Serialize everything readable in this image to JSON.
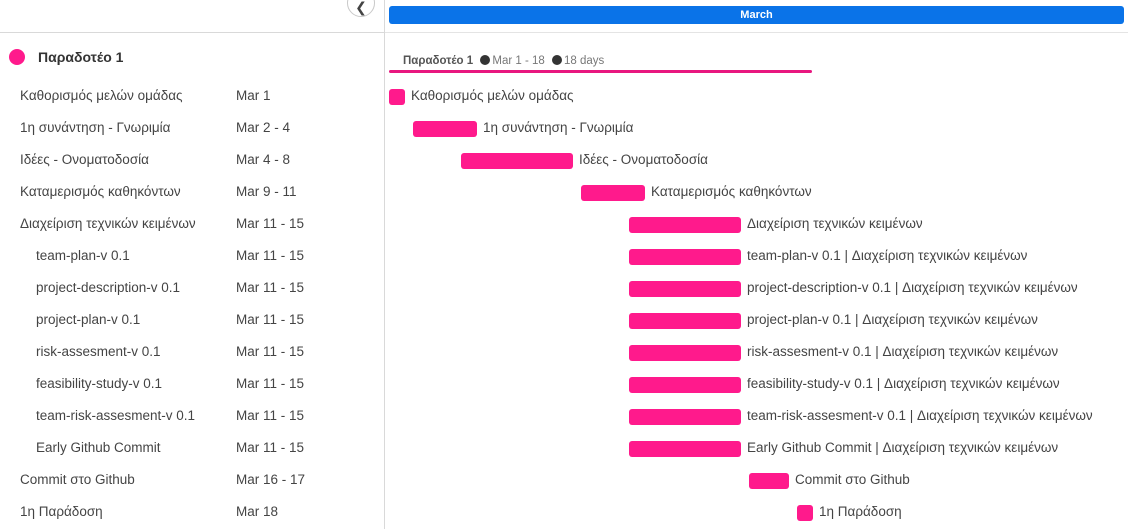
{
  "timeline": {
    "month": "March",
    "summary": {
      "title": "Παραδοτέο 1",
      "range": "Mar 1 - 18",
      "duration": "18 days"
    }
  },
  "group": {
    "title": "Παραδοτέο 1",
    "color": "#ff1a8c"
  },
  "collapse_icon": "chevron-left-icon",
  "tasks": [
    {
      "name": "Καθορισμός μελών ομάδας",
      "dates": "Mar 1",
      "start": 1,
      "end": 1,
      "bar_label": "Καθορισμός μελών ομάδας",
      "indent": false
    },
    {
      "name": "1η συνάντηση - Γνωριμία",
      "dates": "Mar 2 - 4",
      "start": 2,
      "end": 4,
      "bar_label": "1η συνάντηση - Γνωριμία",
      "indent": false
    },
    {
      "name": "Ιδέες - Ονοματοδοσία",
      "dates": "Mar 4 - 8",
      "start": 4,
      "end": 8,
      "bar_label": "Ιδέες - Ονοματοδοσία",
      "indent": false
    },
    {
      "name": "Καταμερισμός καθηκόντων",
      "dates": "Mar 9 - 11",
      "start": 9,
      "end": 11,
      "bar_label": "Καταμερισμός καθηκόντων",
      "indent": false
    },
    {
      "name": "Διαχείριση τεχνικών κειμένων",
      "dates": "Mar 11 - 15",
      "start": 11,
      "end": 15,
      "bar_label": "Διαχείριση τεχνικών κειμένων",
      "indent": false
    },
    {
      "name": "team-plan-v 0.1",
      "dates": "Mar 11 - 15",
      "start": 11,
      "end": 15,
      "bar_label": "team-plan-v 0.1 | Διαχείριση τεχνικών κειμένων",
      "indent": true
    },
    {
      "name": "project-description-v 0.1",
      "dates": "Mar 11 - 15",
      "start": 11,
      "end": 15,
      "bar_label": "project-description-v 0.1 | Διαχείριση τεχνικών κειμένων",
      "indent": true
    },
    {
      "name": "project-plan-v 0.1",
      "dates": "Mar 11 - 15",
      "start": 11,
      "end": 15,
      "bar_label": "project-plan-v 0.1 | Διαχείριση τεχνικών κειμένων",
      "indent": true
    },
    {
      "name": "risk-assesment-v 0.1",
      "dates": "Mar 11 - 15",
      "start": 11,
      "end": 15,
      "bar_label": "risk-assesment-v 0.1 | Διαχείριση τεχνικών κειμένων",
      "indent": true
    },
    {
      "name": "feasibility-study-v 0.1",
      "dates": "Mar 11 - 15",
      "start": 11,
      "end": 15,
      "bar_label": "feasibility-study-v 0.1 | Διαχείριση τεχνικών κειμένων",
      "indent": true
    },
    {
      "name": "team-risk-assesment-v 0.1",
      "dates": "Mar 11 - 15",
      "start": 11,
      "end": 15,
      "bar_label": "team-risk-assesment-v 0.1 | Διαχείριση τεχνικών κειμένων",
      "indent": true
    },
    {
      "name": "Early Github Commit",
      "dates": "Mar 11 - 15",
      "start": 11,
      "end": 15,
      "bar_label": "Early Github Commit | Διαχείριση τεχνικών κειμένων",
      "indent": true
    },
    {
      "name": "Commit στο Github",
      "dates": "Mar 16 - 17",
      "start": 16,
      "end": 17,
      "bar_label": "Commit στο Github",
      "indent": false
    },
    {
      "name": "1η Παράδοση",
      "dates": "Mar 18",
      "start": 18,
      "end": 18,
      "bar_label": "1η Παράδοση",
      "indent": false
    }
  ]
}
